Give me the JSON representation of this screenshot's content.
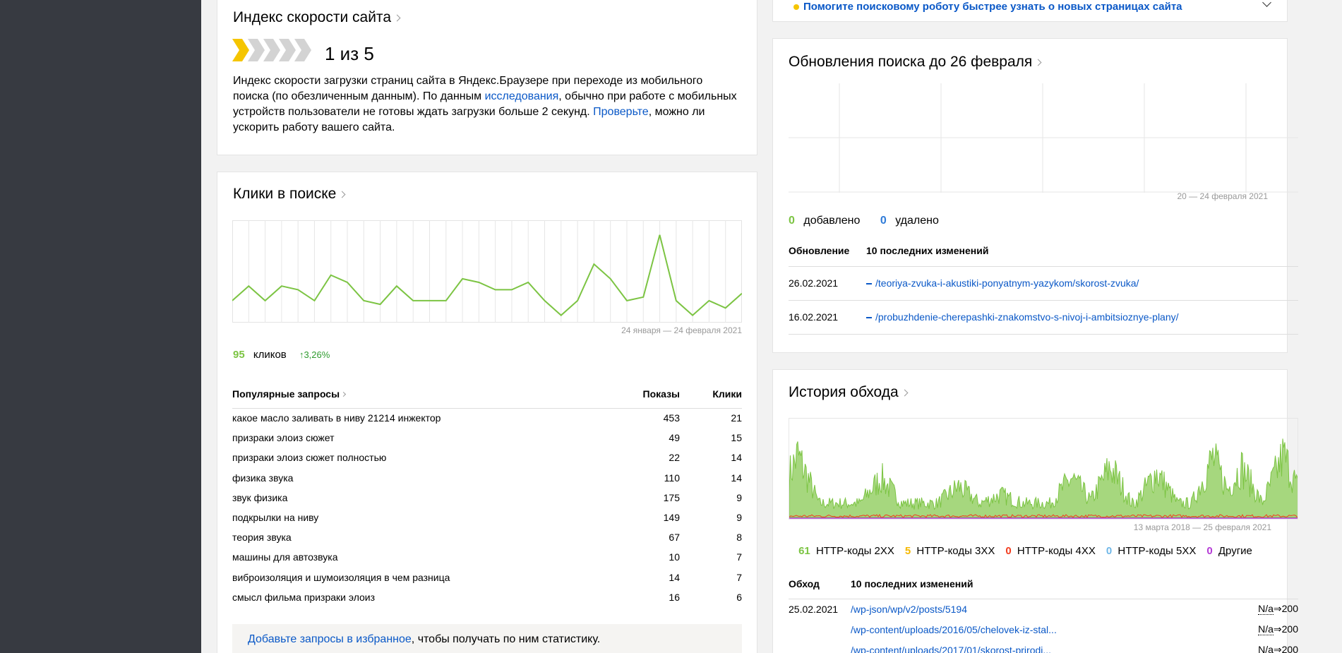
{
  "speed": {
    "title": "Индекс скорости сайта",
    "score": "1 из 5",
    "rating": 1,
    "rating_max": 5,
    "desc_1": "Индекс скорости загрузки страниц сайта в Яндекс.Браузере при переходе из мобильного поиска (по обезличенным данным). По данным ",
    "desc_link": "исследования",
    "desc_2": ", обычно при работе с мобильных устройств пользователи не готовы ждать загрузки больше 2 секунд. ",
    "desc_link2": "Проверьте",
    "desc_3": ", можно ли ускорить работу вашего сайта."
  },
  "clicks": {
    "title": "Клики в поиске",
    "period": "24 января — 24 февраля 2021",
    "count": "95",
    "count_label": "кликов",
    "change": "↑3,26%",
    "table": {
      "headers": [
        "Популярные запросы",
        "Показы",
        "Клики"
      ],
      "rows": [
        [
          "какое масло заливать в ниву 21214 инжектор",
          "453",
          "21"
        ],
        [
          "призраки элоиз сюжет",
          "49",
          "15"
        ],
        [
          "призраки элоиз сюжет полностью",
          "22",
          "14"
        ],
        [
          "физика звука",
          "110",
          "14"
        ],
        [
          "звук физика",
          "175",
          "9"
        ],
        [
          "подкрылки на ниву",
          "149",
          "9"
        ],
        [
          "теория звука",
          "67",
          "8"
        ],
        [
          "машины для автозвука",
          "10",
          "7"
        ],
        [
          "виброизоляция и шумоизоляция в чем разница",
          "14",
          "7"
        ],
        [
          "смысл фильма призраки элоиз",
          "16",
          "6"
        ]
      ]
    },
    "favorites_link": "Добавьте запросы в избранное",
    "favorites_text": ", чтобы получать по ним статистику."
  },
  "notice": {
    "text": "Помогите поисковому роботу быстрее узнать о новых страницах сайта",
    "dot_color": "#f5c500"
  },
  "updates": {
    "title": "Обновления поиска до 26 февраля",
    "period": "20 — 24 февраля 2021",
    "added_count": "0",
    "added_label": "добавлено",
    "removed_count": "0",
    "removed_label": "удалено",
    "headers": [
      "Обновление",
      "10 последних изменений"
    ],
    "rows": [
      [
        "26.02.2021",
        "/teoriya-zvuka-i-akustiki-ponyatnym-yazykom/skorost-zvuka/"
      ],
      [
        "16.02.2021",
        "/probuzhdenie-cherepashki-znakomstvo-s-nivoj-i-ambitsioznye-plany/"
      ]
    ]
  },
  "crawl": {
    "title": "История обхода",
    "period": "13 марта 2018 — 25 февраля 2021",
    "legend": [
      {
        "count": "61",
        "label": "HTTP-коды 2XX",
        "color": "#7cc443"
      },
      {
        "count": "5",
        "label": "HTTP-коды 3XX",
        "color": "#f5b800"
      },
      {
        "count": "0",
        "label": "HTTP-коды 4XX",
        "color": "#f23c1e"
      },
      {
        "count": "0",
        "label": "HTTP-коды 5XX",
        "color": "#6fb7e8"
      },
      {
        "count": "0",
        "label": "Другие",
        "color": "#b43ad6"
      }
    ],
    "headers": [
      "Обход",
      "10 последних изменений"
    ],
    "rows": [
      {
        "date": "25.02.2021",
        "url": "/wp-json/wp/v2/posts/5194",
        "from": "N/a",
        "to": "200"
      },
      {
        "date": "",
        "url": "/wp-content/uploads/2016/05/chelovek-iz-stal...",
        "from": "N/a",
        "to": "200"
      },
      {
        "date": "",
        "url": "/wp-content/uploads/2017/01/skorost-prirodi...",
        "from": "N/a",
        "to": "200"
      }
    ]
  },
  "chart_data": [
    {
      "type": "line",
      "name": "clicks",
      "x_count": 31,
      "values": [
        3,
        5,
        3,
        5,
        4.5,
        3,
        6.5,
        5.5,
        3,
        2.5,
        5,
        3,
        3,
        3,
        6,
        5.5,
        4.5,
        4.5,
        5.5,
        3,
        1,
        3,
        8,
        6,
        3,
        3.5,
        12,
        3,
        1,
        3,
        2,
        4
      ],
      "ylim": [
        0,
        14
      ],
      "color": "#7cc443",
      "grid": true
    },
    {
      "type": "line",
      "name": "search-updates",
      "values": [],
      "grid": true
    },
    {
      "type": "area",
      "name": "crawl-history",
      "color": "#8cc862",
      "grid": false
    }
  ]
}
